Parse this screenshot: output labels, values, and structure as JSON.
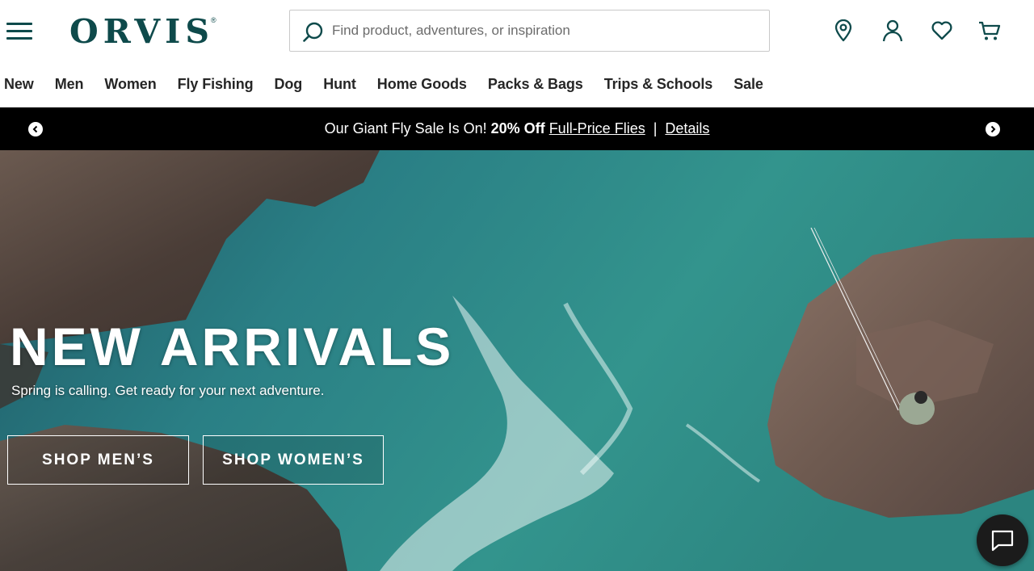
{
  "header": {
    "logo_text": "ORVIS",
    "logo_mark": "®",
    "search_placeholder": "Find product, adventures, or inspiration",
    "icons": [
      "menu-icon",
      "search-icon",
      "location-pin-icon",
      "account-icon",
      "heart-icon",
      "cart-icon"
    ]
  },
  "nav": {
    "items": [
      {
        "label": "New"
      },
      {
        "label": "Men"
      },
      {
        "label": "Women"
      },
      {
        "label": "Fly Fishing"
      },
      {
        "label": "Dog"
      },
      {
        "label": "Hunt"
      },
      {
        "label": "Home Goods"
      },
      {
        "label": "Packs & Bags"
      },
      {
        "label": "Trips & Schools"
      },
      {
        "label": "Sale"
      }
    ]
  },
  "promo": {
    "text": "Our Giant Fly Sale Is On!",
    "bold": "20% Off",
    "link1": "Full-Price Flies",
    "separator": "|",
    "link2": "Details"
  },
  "hero": {
    "title": "NEW ARRIVALS",
    "subtitle": "Spring is calling. Get ready for your next adventure.",
    "cta_men": "SHOP MEN’S",
    "cta_women": "SHOP WOMEN’S"
  },
  "colors": {
    "brand": "#0e4a4b",
    "promo_bg": "#000000",
    "water": "#2f8a86"
  }
}
